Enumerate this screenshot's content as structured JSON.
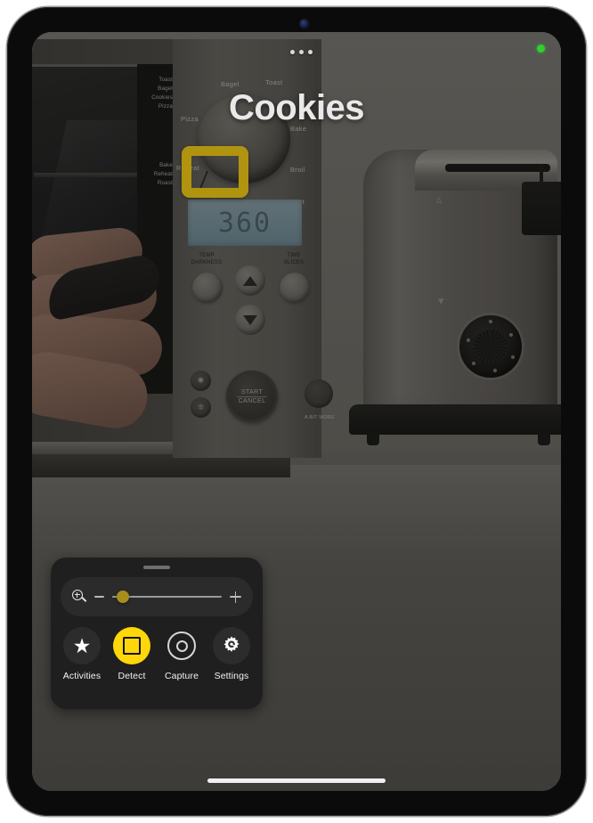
{
  "device": {
    "front_camera": "front-camera-dot",
    "home_indicator": "home-indicator"
  },
  "status": {
    "camera_active_indicator": "green-recording-dot",
    "camera_active_color": "#2fd02f"
  },
  "overlay": {
    "more_menu": "three-dots-menu",
    "detected_text": "Cookies",
    "detection_box_color": "#b0940f"
  },
  "control_panel": {
    "grabber": "drag-handle",
    "zoom": {
      "magnifier_icon": "magnifier-plus-icon",
      "decrease_label": "−",
      "increase_label": "+",
      "thumb_color": "#a88f1b",
      "value_percent": 4
    },
    "buttons": [
      {
        "id": "activities",
        "label": "Activities",
        "icon": "star-icon",
        "active": false
      },
      {
        "id": "detect",
        "label": "Detect",
        "icon": "detect-frame-icon",
        "active": true
      },
      {
        "id": "capture",
        "label": "Capture",
        "icon": "capture-ring-icon",
        "active": false
      },
      {
        "id": "settings",
        "label": "Settings",
        "icon": "gear-icon",
        "active": false
      }
    ],
    "accent_color": "#ffd60a"
  },
  "scene": {
    "oven": {
      "lcd_value": "360",
      "dial_labels": [
        "Bagel",
        "Toast",
        "Pizza",
        "Bake",
        "Reheat",
        "Broil",
        "Roast"
      ],
      "menu_strip_labels": [
        "Toast",
        "Bagel",
        "Cookies",
        "Pizza",
        "Bake",
        "Reheat",
        "Roast"
      ],
      "button_labels": {
        "temp": "TEMP",
        "temp_sub": "DARKNESS",
        "time": "TIME",
        "time_sub": "SLICES",
        "start": "START",
        "cancel": "CANCEL",
        "a_bit_more": "A BIT MORE"
      },
      "highlighted_label": "Cookies"
    }
  }
}
